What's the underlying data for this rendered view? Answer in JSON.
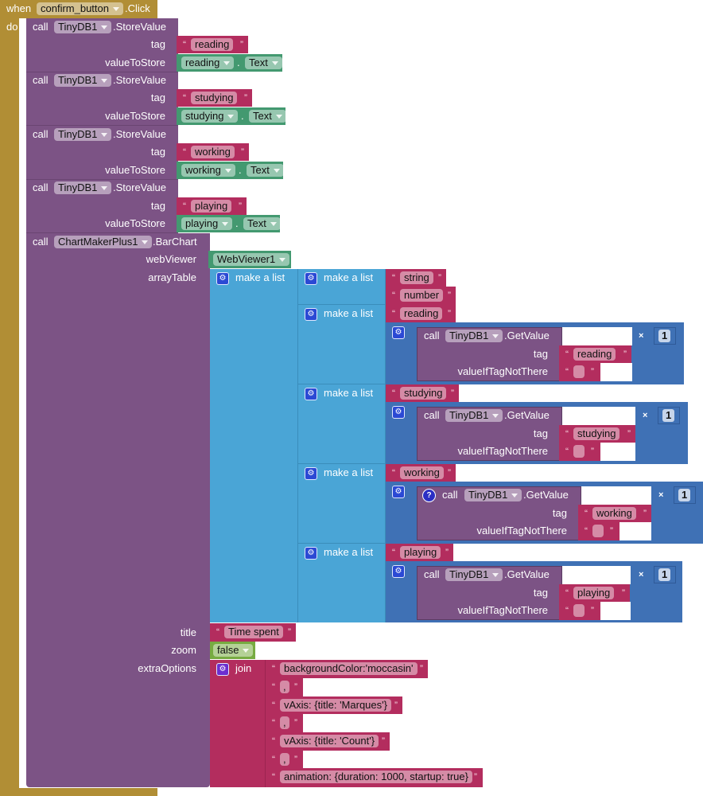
{
  "event": {
    "when": "when",
    "component": "confirm_button",
    "event": ".Click",
    "do": "do"
  },
  "store_blocks": [
    {
      "call": "call",
      "component": "TinyDB1",
      "method": ".StoreValue",
      "tag_label": "tag",
      "tag_value": "reading",
      "value_label": "valueToStore",
      "value_component": "reading",
      "value_prop": "Text"
    },
    {
      "call": "call",
      "component": "TinyDB1",
      "method": ".StoreValue",
      "tag_label": "tag",
      "tag_value": "studying",
      "value_label": "valueToStore",
      "value_component": "studying",
      "value_prop": "Text"
    },
    {
      "call": "call",
      "component": "TinyDB1",
      "method": ".StoreValue",
      "tag_label": "tag",
      "tag_value": "working",
      "value_label": "valueToStore",
      "value_component": "working",
      "value_prop": "Text"
    },
    {
      "call": "call",
      "component": "TinyDB1",
      "method": ".StoreValue",
      "tag_label": "tag",
      "tag_value": "playing",
      "value_label": "valueToStore",
      "value_component": "playing",
      "value_prop": "Text"
    }
  ],
  "chart": {
    "call": "call",
    "component": "ChartMakerPlus1",
    "method": ".BarChart",
    "webViewer_label": "webViewer",
    "webViewer_value": "WebViewer1",
    "arrayTable_label": "arrayTable",
    "make_list": "make a list",
    "header_row": [
      "string",
      "number"
    ],
    "rows": [
      {
        "tag": "reading",
        "call": "call",
        "component": "TinyDB1",
        "method": ".GetValue",
        "tag_label": "tag",
        "tag_value": "reading",
        "default_label": "valueIfTagNotThere",
        "default_value": "",
        "times": "×",
        "multiplier": "1",
        "has_help": false
      },
      {
        "tag": "studying",
        "call": "call",
        "component": "TinyDB1",
        "method": ".GetValue",
        "tag_label": "tag",
        "tag_value": "studying",
        "default_label": "valueIfTagNotThere",
        "default_value": "",
        "times": "×",
        "multiplier": "1",
        "has_help": false
      },
      {
        "tag": "working",
        "call": "call",
        "component": "TinyDB1",
        "method": ".GetValue",
        "tag_label": "tag",
        "tag_value": "working",
        "default_label": "valueIfTagNotThere",
        "default_value": "",
        "times": "×",
        "multiplier": "1",
        "has_help": true,
        "help": "?"
      },
      {
        "tag": "playing",
        "call": "call",
        "component": "TinyDB1",
        "method": ".GetValue",
        "tag_label": "tag",
        "tag_value": "playing",
        "default_label": "valueIfTagNotThere",
        "default_value": "",
        "times": "×",
        "multiplier": "1",
        "has_help": false
      }
    ],
    "title_label": "title",
    "title_value": "Time spent",
    "zoom_label": "zoom",
    "zoom_value": "false",
    "extra_label": "extraOptions",
    "join": "join",
    "join_items": [
      "backgroundColor:'moccasin'",
      ",",
      "vAxis: {title: 'Marques'}",
      ",",
      "vAxis: {title: 'Count'}",
      ",",
      "animation: {duration: 1000, startup: true}"
    ]
  },
  "colors": {
    "event": "#b18e35",
    "procedure": "#7c5385",
    "text": "#b32d5e",
    "component": "#439970",
    "list": "#4aa5d6",
    "math": "#3f71b5",
    "logic": "#77ab41"
  }
}
